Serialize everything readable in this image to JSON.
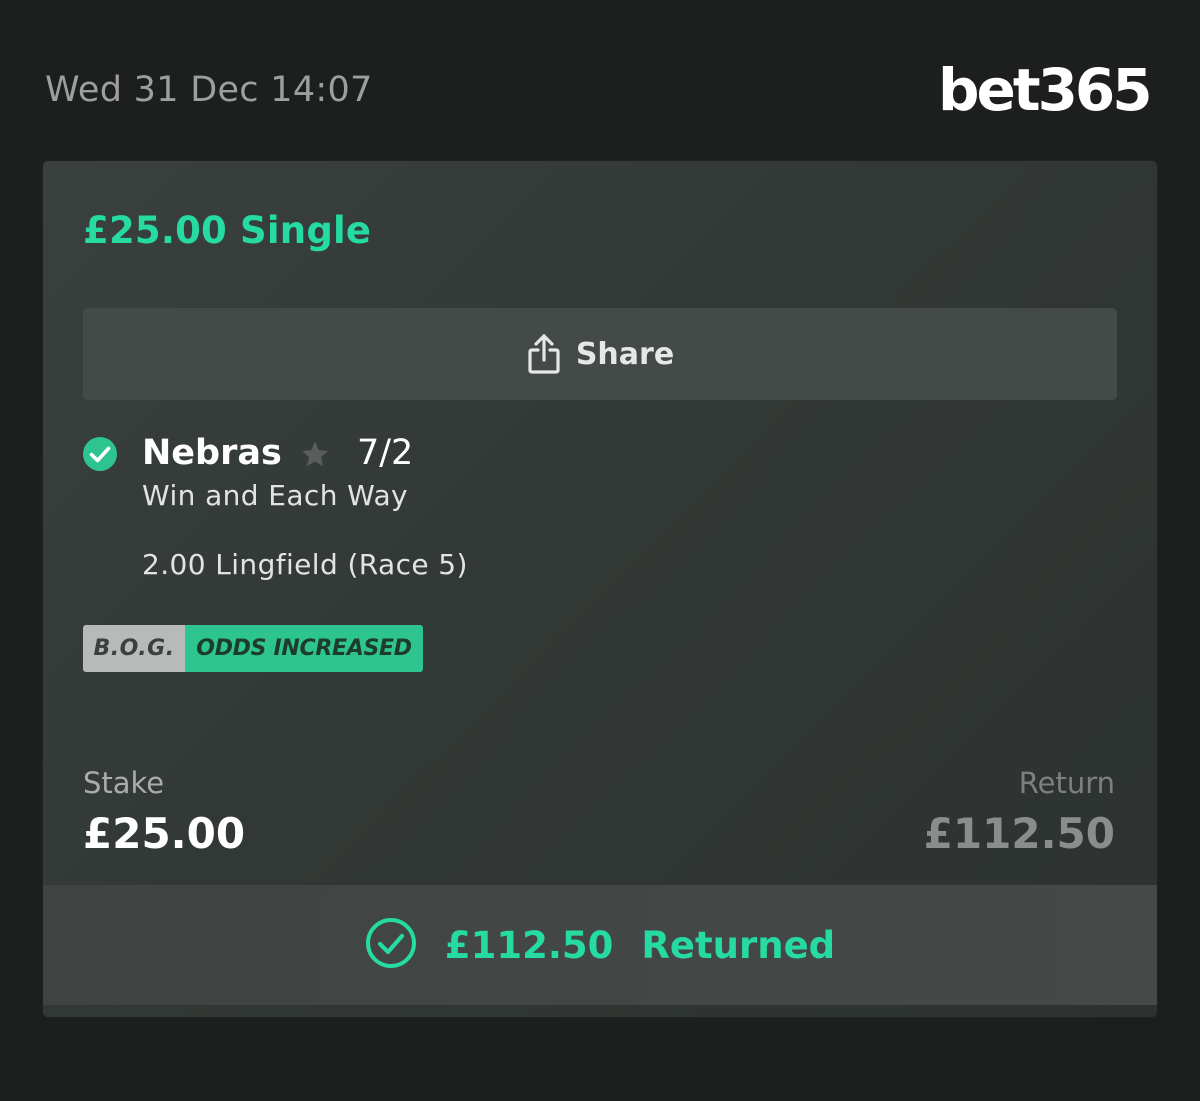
{
  "header": {
    "datetime": "Wed 31 Dec 14:07",
    "brand": "bet365"
  },
  "bet": {
    "title": "£25.00 Single",
    "share_label": "Share",
    "selection": {
      "name": "Nebras",
      "odds": "7/2",
      "market": "Win and Each Way",
      "event": "2.00 Lingfield (Race 5)",
      "status_icon": "check-circle-icon"
    },
    "badge": {
      "left": "B.O.G.",
      "right": "ODDS INCREASED"
    },
    "stake_label": "Stake",
    "stake_value": "£25.00",
    "return_label": "Return",
    "return_value": "£112.50",
    "footer": {
      "amount": "£112.50",
      "status": "Returned"
    }
  },
  "colors": {
    "background": "#1d1e1e",
    "accent_green": "#25dba2",
    "badge_green": "#2ec48f",
    "card": "#353b39"
  }
}
